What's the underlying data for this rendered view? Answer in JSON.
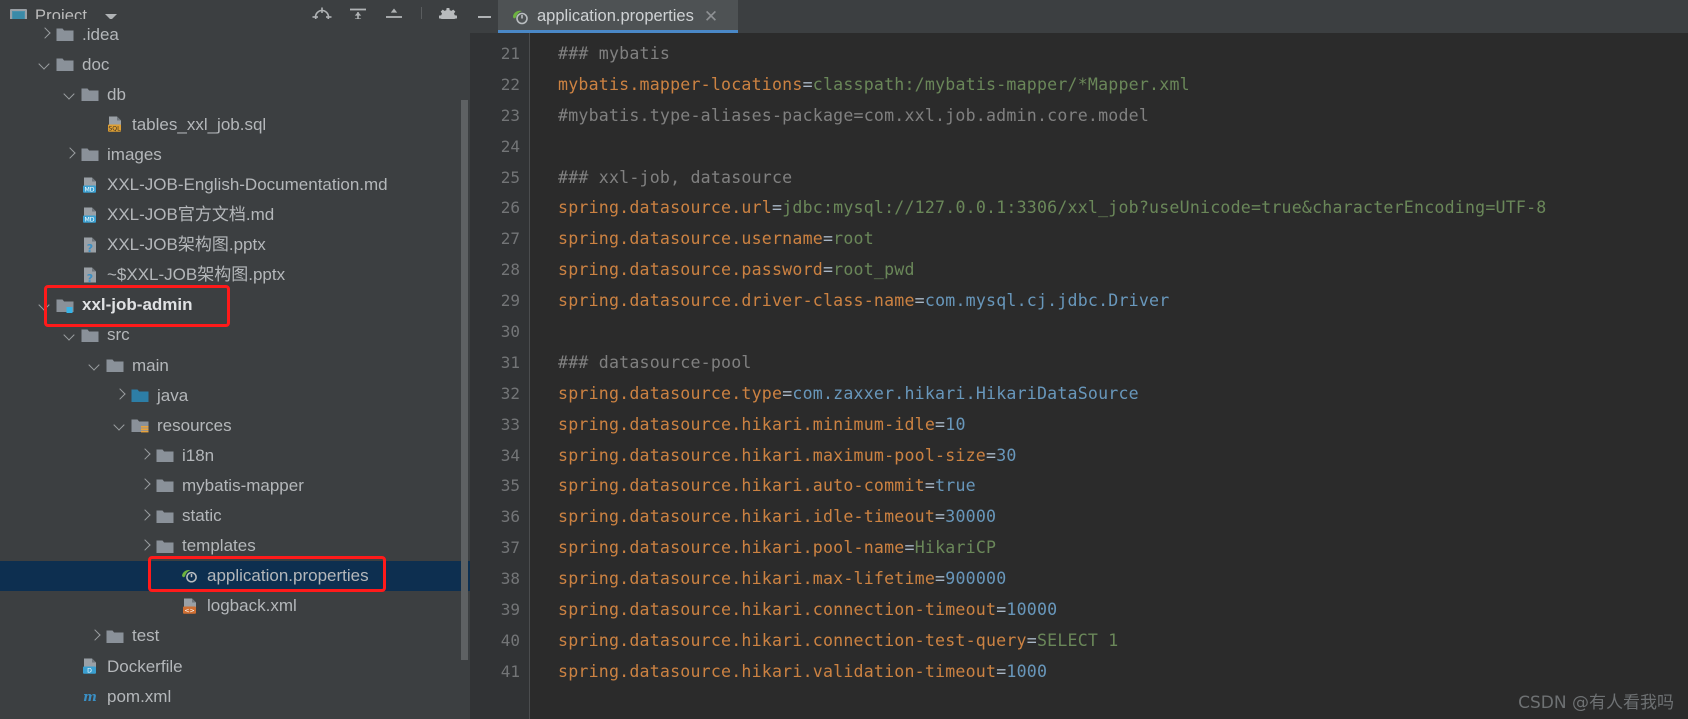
{
  "project_pane": {
    "title": "Project",
    "title_icon": "project-window-icon",
    "dropdown_icon": "chevron-down-icon",
    "toolbar_buttons": [
      {
        "name": "select-opened-file-icon",
        "label": "Select Opened File"
      },
      {
        "name": "expand-all-icon",
        "label": "Expand All"
      },
      {
        "name": "collapse-all-icon",
        "label": "Collapse All"
      },
      {
        "name": "settings-gear-icon",
        "label": "Settings"
      }
    ],
    "tree": [
      {
        "label": ".idea",
        "indent": 1,
        "arrow": "right",
        "icon": "folder",
        "selected": false,
        "bold": false
      },
      {
        "label": "doc",
        "indent": 1,
        "arrow": "down",
        "icon": "folder",
        "selected": false,
        "bold": false
      },
      {
        "label": "db",
        "indent": 2,
        "arrow": "down",
        "icon": "folder",
        "selected": false,
        "bold": false
      },
      {
        "label": "tables_xxl_job.sql",
        "indent": 3,
        "arrow": "none",
        "icon": "sql",
        "selected": false,
        "bold": false
      },
      {
        "label": "images",
        "indent": 2,
        "arrow": "right",
        "icon": "folder",
        "selected": false,
        "bold": false
      },
      {
        "label": "XXL-JOB-English-Documentation.md",
        "indent": 2,
        "arrow": "none",
        "icon": "md",
        "selected": false,
        "bold": false
      },
      {
        "label": "XXL-JOB官方文档.md",
        "indent": 2,
        "arrow": "none",
        "icon": "md",
        "selected": false,
        "bold": false
      },
      {
        "label": "XXL-JOB架构图.pptx",
        "indent": 2,
        "arrow": "none",
        "icon": "unknown",
        "selected": false,
        "bold": false
      },
      {
        "label": "~$XXL-JOB架构图.pptx",
        "indent": 2,
        "arrow": "none",
        "icon": "unknown",
        "selected": false,
        "bold": false
      },
      {
        "label": "xxl-job-admin",
        "indent": 1,
        "arrow": "down",
        "icon": "module",
        "selected": false,
        "bold": true
      },
      {
        "label": "src",
        "indent": 2,
        "arrow": "down",
        "icon": "folder",
        "selected": false,
        "bold": false
      },
      {
        "label": "main",
        "indent": 3,
        "arrow": "down",
        "icon": "folder",
        "selected": false,
        "bold": false
      },
      {
        "label": "java",
        "indent": 4,
        "arrow": "right",
        "icon": "source",
        "selected": false,
        "bold": false
      },
      {
        "label": "resources",
        "indent": 4,
        "arrow": "down",
        "icon": "resources",
        "selected": false,
        "bold": false
      },
      {
        "label": "i18n",
        "indent": 5,
        "arrow": "right",
        "icon": "folder",
        "selected": false,
        "bold": false
      },
      {
        "label": "mybatis-mapper",
        "indent": 5,
        "arrow": "right",
        "icon": "folder",
        "selected": false,
        "bold": false
      },
      {
        "label": "static",
        "indent": 5,
        "arrow": "right",
        "icon": "folder",
        "selected": false,
        "bold": false
      },
      {
        "label": "templates",
        "indent": 5,
        "arrow": "right",
        "icon": "folder",
        "selected": false,
        "bold": false
      },
      {
        "label": "application.properties",
        "indent": 6,
        "arrow": "none",
        "icon": "spring",
        "selected": true,
        "bold": false
      },
      {
        "label": "logback.xml",
        "indent": 6,
        "arrow": "none",
        "icon": "xml",
        "selected": false,
        "bold": false
      },
      {
        "label": "test",
        "indent": 3,
        "arrow": "right",
        "icon": "folder",
        "selected": false,
        "bold": false
      },
      {
        "label": "Dockerfile",
        "indent": 2,
        "arrow": "none",
        "icon": "docker",
        "selected": false,
        "bold": false
      },
      {
        "label": "pom.xml",
        "indent": 2,
        "arrow": "none",
        "icon": "maven",
        "selected": false,
        "bold": false
      }
    ],
    "annotations": [
      {
        "name": "highlight-xxl-job-admin",
        "color": "#ff1a1a"
      },
      {
        "name": "highlight-application-properties",
        "color": "#ff1a1a"
      }
    ]
  },
  "editor": {
    "tab": {
      "label": "application.properties",
      "icon": "spring-properties-icon",
      "close_icon": "close-icon",
      "active_accent": "#4a88c7"
    },
    "minimize_icon": "minimize-icon",
    "first_line_number": 21,
    "lines": [
      {
        "num": 21,
        "parts": [
          {
            "t": "### mybatis",
            "c": "c"
          }
        ]
      },
      {
        "num": 22,
        "parts": [
          {
            "t": "mybatis.mapper-locations",
            "c": "k"
          },
          {
            "t": "=",
            "c": "eq"
          },
          {
            "t": "classpath:/mybatis-mapper/*Mapper.xml",
            "c": "s"
          }
        ]
      },
      {
        "num": 23,
        "parts": [
          {
            "t": "#mybatis.type-aliases-package=com.xxl.job.admin.core.model",
            "c": "c"
          }
        ]
      },
      {
        "num": 24,
        "parts": [
          {
            "t": "",
            "c": "c"
          }
        ]
      },
      {
        "num": 25,
        "parts": [
          {
            "t": "### xxl-job, datasource",
            "c": "c"
          }
        ]
      },
      {
        "num": 26,
        "parts": [
          {
            "t": "spring.datasource.url",
            "c": "k"
          },
          {
            "t": "=",
            "c": "eq"
          },
          {
            "t": "jdbc:mysql://127.0.0.1:3306/xxl_job?useUnicode=true&characterEncoding=UTF-8",
            "c": "s"
          }
        ]
      },
      {
        "num": 27,
        "parts": [
          {
            "t": "spring.datasource.username",
            "c": "k"
          },
          {
            "t": "=",
            "c": "eq"
          },
          {
            "t": "root",
            "c": "s"
          }
        ]
      },
      {
        "num": 28,
        "parts": [
          {
            "t": "spring.datasource.password",
            "c": "k"
          },
          {
            "t": "=",
            "c": "eq"
          },
          {
            "t": "root_pwd",
            "c": "s"
          }
        ]
      },
      {
        "num": 29,
        "parts": [
          {
            "t": "spring.datasource.driver-class-name",
            "c": "k"
          },
          {
            "t": "=",
            "c": "eq"
          },
          {
            "t": "com.mysql.cj.jdbc.Driver",
            "c": "n"
          }
        ]
      },
      {
        "num": 30,
        "parts": [
          {
            "t": "",
            "c": "c"
          }
        ]
      },
      {
        "num": 31,
        "parts": [
          {
            "t": "### datasource-pool",
            "c": "c"
          }
        ]
      },
      {
        "num": 32,
        "parts": [
          {
            "t": "spring.datasource.type",
            "c": "k"
          },
          {
            "t": "=",
            "c": "eq"
          },
          {
            "t": "com.zaxxer.hikari.HikariDataSource",
            "c": "n"
          }
        ]
      },
      {
        "num": 33,
        "parts": [
          {
            "t": "spring.datasource.hikari.minimum-idle",
            "c": "k"
          },
          {
            "t": "=",
            "c": "eq"
          },
          {
            "t": "10",
            "c": "n"
          }
        ]
      },
      {
        "num": 34,
        "parts": [
          {
            "t": "spring.datasource.hikari.maximum-pool-size",
            "c": "k"
          },
          {
            "t": "=",
            "c": "eq"
          },
          {
            "t": "30",
            "c": "n"
          }
        ]
      },
      {
        "num": 35,
        "parts": [
          {
            "t": "spring.datasource.hikari.auto-commit",
            "c": "k"
          },
          {
            "t": "=",
            "c": "eq"
          },
          {
            "t": "true",
            "c": "n"
          }
        ]
      },
      {
        "num": 36,
        "parts": [
          {
            "t": "spring.datasource.hikari.idle-timeout",
            "c": "k"
          },
          {
            "t": "=",
            "c": "eq"
          },
          {
            "t": "30000",
            "c": "n"
          }
        ]
      },
      {
        "num": 37,
        "parts": [
          {
            "t": "spring.datasource.hikari.pool-name",
            "c": "k"
          },
          {
            "t": "=",
            "c": "eq"
          },
          {
            "t": "HikariCP",
            "c": "s"
          }
        ]
      },
      {
        "num": 38,
        "parts": [
          {
            "t": "spring.datasource.hikari.max-lifetime",
            "c": "k"
          },
          {
            "t": "=",
            "c": "eq"
          },
          {
            "t": "900000",
            "c": "n"
          }
        ]
      },
      {
        "num": 39,
        "parts": [
          {
            "t": "spring.datasource.hikari.connection-timeout",
            "c": "k"
          },
          {
            "t": "=",
            "c": "eq"
          },
          {
            "t": "10000",
            "c": "n"
          }
        ]
      },
      {
        "num": 40,
        "parts": [
          {
            "t": "spring.datasource.hikari.connection-test-query",
            "c": "k"
          },
          {
            "t": "=",
            "c": "eq"
          },
          {
            "t": "SELECT 1",
            "c": "s"
          }
        ]
      },
      {
        "num": 41,
        "parts": [
          {
            "t": "spring.datasource.hikari.validation-timeout",
            "c": "k"
          },
          {
            "t": "=",
            "c": "eq"
          },
          {
            "t": "1000",
            "c": "n"
          }
        ]
      }
    ]
  },
  "watermark": "CSDN @有人看我吗",
  "colors": {
    "panel_bg": "#3c3f41",
    "editor_bg": "#2b2b2b",
    "gutter_bg": "#313335",
    "selection_bg": "#0d2f50",
    "key": "#cc8242",
    "string": "#6a8759",
    "number": "#6897bb",
    "comment": "#808080",
    "annotation": "#ff1a1a"
  }
}
